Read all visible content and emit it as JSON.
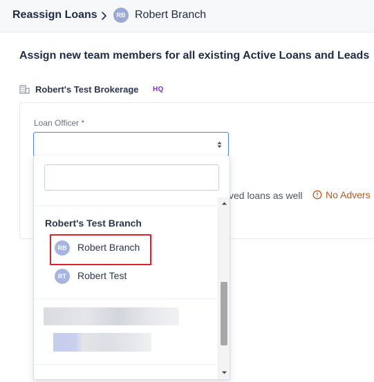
{
  "breadcrumb": {
    "root": "Reassign Loans",
    "current_initials": "RB",
    "current_name": "Robert Branch"
  },
  "page_title": "Assign new team members for all existing Active Loans and Leads",
  "brokerage": {
    "name": "Robert's Test Brokerage",
    "badge": "HQ",
    "icon": "building-icon"
  },
  "loan_officer_field": {
    "label": "Loan Officer *",
    "value": "",
    "search_value": ""
  },
  "behind_content": {
    "partial_text": "ved loans as well",
    "warning_text": "No Advers",
    "warning_icon": "info-circle-icon"
  },
  "dropdown": {
    "group_label": "Robert's Test Branch",
    "options": [
      {
        "initials": "RB",
        "name": "Robert Branch"
      },
      {
        "initials": "RT",
        "name": "Robert Test"
      }
    ]
  },
  "colors": {
    "accent_blue": "#4c84e6",
    "highlight_red": "#e0202a",
    "warning_orange": "#c2571a",
    "hq_purple": "#7b2fd0",
    "avatar": "#a6b4e0"
  }
}
